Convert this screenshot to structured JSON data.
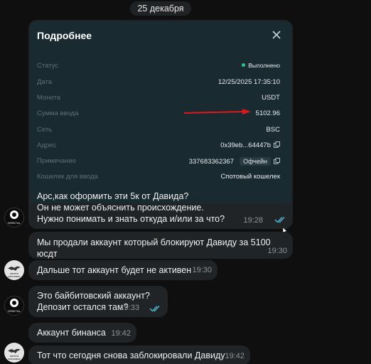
{
  "date_label": "25 декабря",
  "screenshot": {
    "title": "Подробнее",
    "rows": [
      {
        "key": "Статус",
        "value": "Выполнено"
      },
      {
        "key": "Дата",
        "value": "12/25/2025 17:35:10"
      },
      {
        "key": "Монета",
        "value": "USDT"
      },
      {
        "key": "Сумма ввода",
        "value": "5102.96"
      },
      {
        "key": "Сеть",
        "value": "BSC"
      },
      {
        "key": "Адрес",
        "value": "0x39eb...64447b"
      },
      {
        "key": "Примечание",
        "value": "337683362367"
      },
      {
        "key": "Кошелек для ввода",
        "value": "Спотовый кошелек"
      }
    ],
    "offline_badge": "Офчейн",
    "status_color": "#2fc48d",
    "arrow_color": "#e0181b"
  },
  "messages": [
    {
      "lines": [
        "Арс,как оформить эти 5к от Давида?",
        "Он не может объяснить происхождение.",
        "Нужно понимать и знать откуда и/или за что?"
      ],
      "time": "19:28",
      "read": true
    },
    {
      "lines": [
        "Мы продали аккаунт который блокируют Давиду за 5100 юсдт"
      ],
      "time": "19:30"
    },
    {
      "lines": [
        "Дальше тот аккаунт будет не активен"
      ],
      "time": "19:30"
    },
    {
      "lines": [
        "Это байбитовский аккаунт?",
        "Депозит остался там?"
      ],
      "time": "19:33",
      "read": true
    },
    {
      "lines": [
        "Аккаунт бинанса"
      ],
      "time": "19:42"
    },
    {
      "lines": [
        "Тот что сегодня снова заблокировали Давиду"
      ],
      "time": "19:42"
    }
  ],
  "avatars": {
    "orbital_label": "ORBITAL",
    "logo_label": "CRYPTO EXCHANGE"
  },
  "colors": {
    "read_ticks": "#4fb8d8",
    "bubble": "#202426",
    "background": "#0f0f0f"
  }
}
